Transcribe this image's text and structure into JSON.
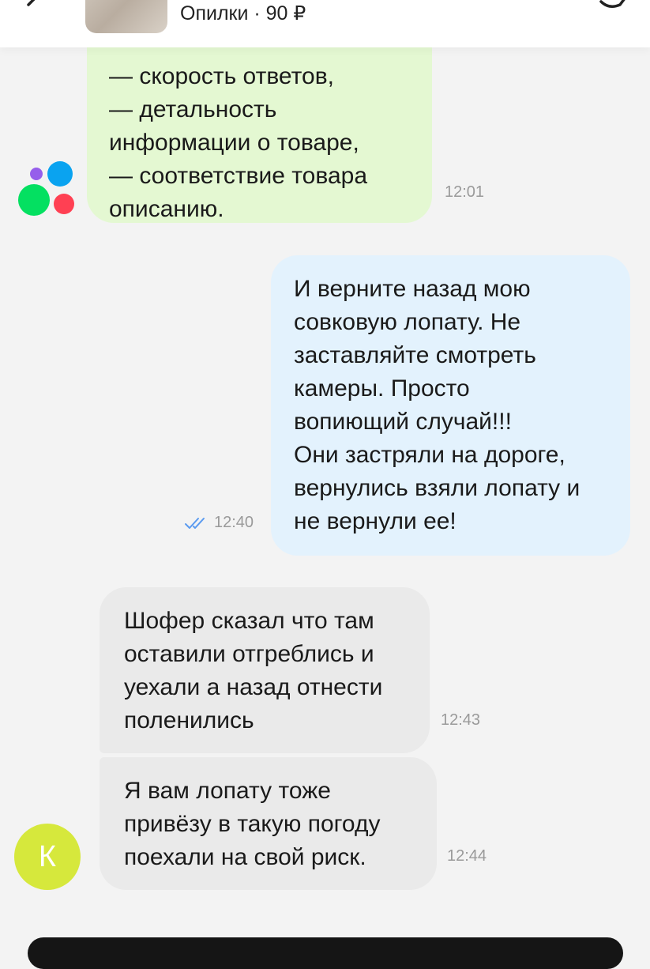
{
  "header": {
    "title": "Опилки · 90 ₽",
    "back_icon": "chevron-left-icon",
    "right_icon": "more-icon"
  },
  "messages": [
    {
      "side": "incoming",
      "sender": "avito-support",
      "text": "— скорость ответов,\n— детальность\nинформации о товаре,\n— соответствие товара\nописанию.",
      "time": "12:01",
      "color": "#e4f8d2"
    },
    {
      "side": "outgoing",
      "text": "И верните назад мою\nсовковую лопату. Не\nзаставляйте смотреть\nкамеры. Просто\nвопиющий случай!!!\nОни застряли на дороге,\nвернулись взяли лопату и\nне вернули ее!",
      "time": "12:40",
      "read": true,
      "color": "#e3f2fd"
    },
    {
      "side": "incoming",
      "sender": "K",
      "text": "Шофер сказал что там\nоставили отгреблись и\nуехали а назад отнести\nполенились",
      "time": "12:43",
      "color": "#eaeaea"
    },
    {
      "side": "incoming",
      "sender": "K",
      "text": "Я вам лопату тоже\nпривёзу  в такую погоду\nпоехали на свой риск.",
      "time": "12:44",
      "color": "#eaeaea"
    }
  ],
  "avatars": {
    "seller_initial": "К",
    "seller_color": "#d6e83c",
    "support_logo": "avito-logo-icon"
  },
  "colors": {
    "read_check": "#5b9bf0"
  }
}
